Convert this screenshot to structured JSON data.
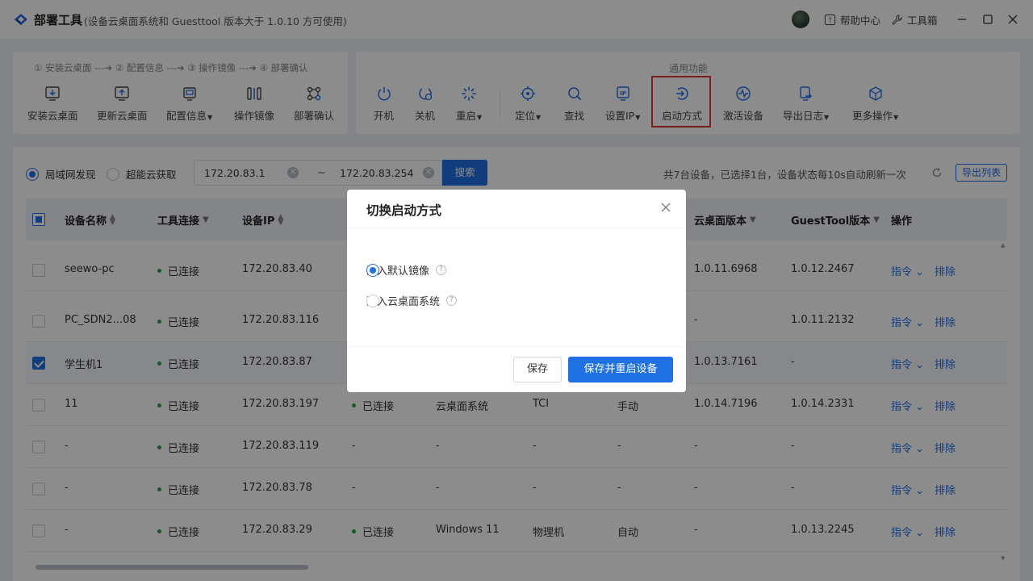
{
  "app": {
    "title": "部署工具",
    "subtitle": "(设备云桌面系统和 Guesttool 版本大于 1.0.10 方可使用)",
    "help_center": "帮助中心",
    "toolbox": "工具箱"
  },
  "deploy": {
    "steps_text": "① 安装云桌面 ---➔ ② 配置信息 ---➔ ③ 操作镜像 ---➔ ④ 部署确认",
    "buttons": {
      "install": "安装云桌面",
      "update": "更新云桌面",
      "config": "配置信息",
      "image": "操作镜像",
      "confirm": "部署确认"
    }
  },
  "common": {
    "label": "通用功能",
    "buttons": {
      "power_on": "开机",
      "power_off": "关机",
      "restart": "重启",
      "locate": "定位",
      "find": "查找",
      "set_ip": "设置IP",
      "boot_mode": "启动方式",
      "activate": "激活设备",
      "export_log": "导出日志",
      "more": "更多操作"
    }
  },
  "filter": {
    "lan_discovery": "局域网发现",
    "cloud_fetch": "超能云获取",
    "ip_start": "172.20.83.1",
    "ip_end": "172.20.83.254",
    "tilde": "~",
    "search": "搜索",
    "info": "共7台设备，已选择1台，设备状态每10s自动刷新一次",
    "export_list": "导出列表"
  },
  "table": {
    "headers": {
      "name": "设备名称",
      "tool_conn": "工具连接",
      "ip": "设备IP",
      "cloud_version": "云桌面版本",
      "guest_version": "GuestTool版本",
      "actions": "操作"
    },
    "command_label": "指令",
    "exclude_label": "排除",
    "rows": [
      {
        "name": "seewo-pc",
        "tool": "已连接",
        "ip": "172.20.83.40",
        "c4": "",
        "c5": "",
        "c6": "",
        "c7": "",
        "cloud": "1.0.11.6968",
        "guest": "1.0.12.2467",
        "checked": false
      },
      {
        "name": "PC_SDN2...08",
        "tool": "已连接",
        "ip": "172.20.83.116",
        "c4": "",
        "c5": "",
        "c6": "",
        "c7": "",
        "cloud": "-",
        "guest": "1.0.11.2132",
        "checked": false
      },
      {
        "name": "学生机1",
        "tool": "已连接",
        "ip": "172.20.83.87",
        "c4": "",
        "c5": "",
        "c6": "",
        "c7": "",
        "cloud": "1.0.13.7161",
        "guest": "-",
        "checked": true
      },
      {
        "name": "11",
        "tool": "已连接",
        "ip": "172.20.83.197",
        "c4": "已连接",
        "c5": "云桌面系统",
        "c6": "TCI",
        "c7": "手动",
        "cloud": "1.0.14.7196",
        "guest": "1.0.14.2331",
        "checked": false
      },
      {
        "name": "-",
        "tool": "已连接",
        "ip": "172.20.83.119",
        "c4": "-",
        "c5": "-",
        "c6": "-",
        "c7": "-",
        "cloud": "-",
        "guest": "-",
        "checked": false
      },
      {
        "name": "-",
        "tool": "已连接",
        "ip": "172.20.83.78",
        "c4": "-",
        "c5": "-",
        "c6": "-",
        "c7": "-",
        "cloud": "-",
        "guest": "-",
        "checked": false
      },
      {
        "name": "-",
        "tool": "已连接",
        "ip": "172.20.83.29",
        "c4": "已连接",
        "c5": "Windows 11",
        "c6": "物理机",
        "c7": "自动",
        "cloud": "-",
        "guest": "1.0.13.2245",
        "checked": false
      }
    ]
  },
  "modal": {
    "title": "切换启动方式",
    "option_default_image": "进入默认镜像",
    "option_cloud_system": "进入云桌面系统",
    "save": "保存",
    "save_restart": "保存并重启设备"
  },
  "colors": {
    "primary": "#1f6fe5",
    "connected": "#22a34a",
    "highlight": "#e53935"
  }
}
